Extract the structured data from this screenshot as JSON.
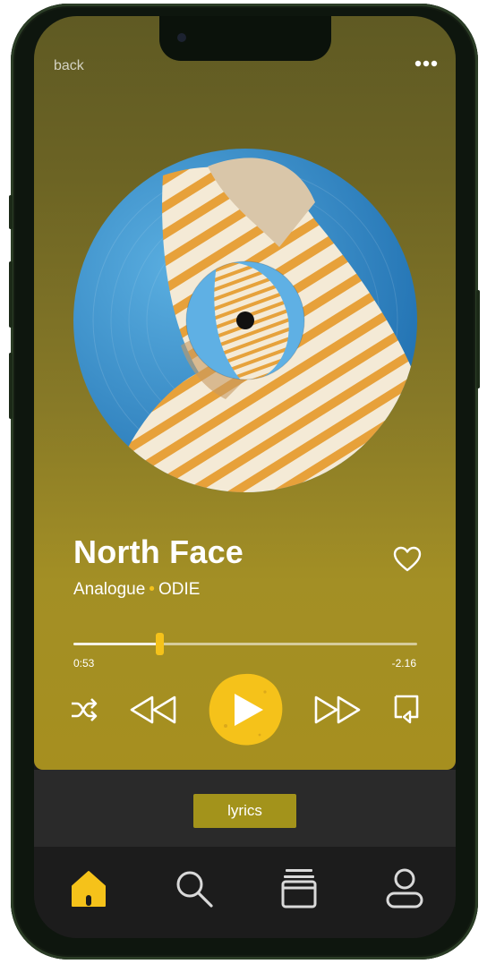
{
  "header": {
    "back_label": "back",
    "more_icon": "more-dots-icon"
  },
  "album": {
    "artwork": "vinyl-record-artwork"
  },
  "track": {
    "title": "North Face",
    "album": "Analogue",
    "separator": "•",
    "artist": "ODIE",
    "liked_icon": "heart-outline-icon"
  },
  "playback": {
    "elapsed": "0:53",
    "remaining": "-2.16",
    "progress_fraction": 0.25
  },
  "controls": {
    "shuffle_icon": "shuffle-icon",
    "previous_icon": "rewind-icon",
    "play_icon": "play-icon",
    "next_icon": "fast-forward-icon",
    "queue_icon": "queue-icon"
  },
  "lyrics": {
    "label": "lyrics"
  },
  "tabs": [
    {
      "name": "home",
      "icon": "home-icon",
      "active": true
    },
    {
      "name": "search",
      "icon": "search-icon",
      "active": false
    },
    {
      "name": "library",
      "icon": "library-icon",
      "active": false
    },
    {
      "name": "profile",
      "icon": "profile-icon",
      "active": false
    }
  ],
  "colors": {
    "accent": "#f5c21a",
    "player_gradient_top": "#5f5a23",
    "player_gradient_bottom": "#a68f1f",
    "lyrics_button": "#a3931b",
    "tab_bar": "#1c1c1c"
  }
}
